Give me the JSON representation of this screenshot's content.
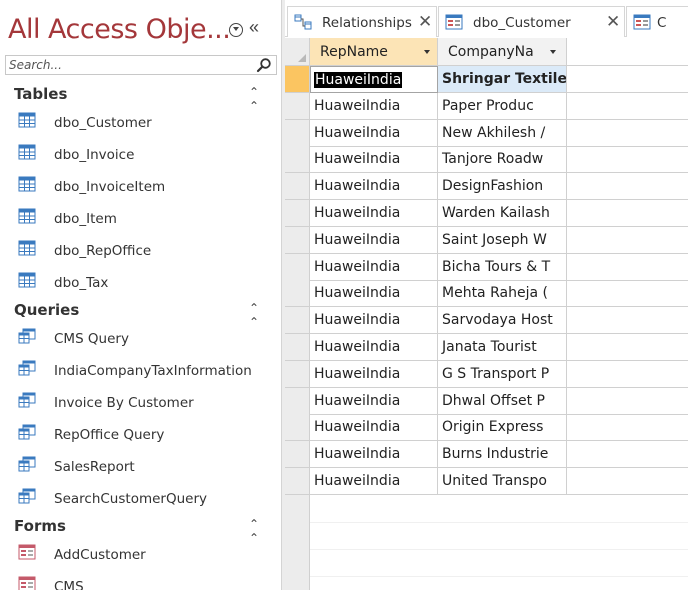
{
  "nav": {
    "title": "All Access Obje...",
    "collapse_glyph": "«",
    "search_placeholder": "Search...",
    "groups": [
      {
        "title": "Tables",
        "chevron": "≈",
        "icon": "table-icon",
        "items": [
          "dbo_Customer",
          "dbo_Invoice",
          "dbo_InvoiceItem",
          "dbo_Item",
          "dbo_RepOffice",
          "dbo_Tax"
        ]
      },
      {
        "title": "Queries",
        "chevron": "≈",
        "icon": "query-icon",
        "items": [
          "CMS Query",
          "IndiaCompanyTaxInformation",
          "Invoice By Customer",
          "RepOffice Query",
          "SalesReport",
          "SearchCustomerQuery"
        ]
      },
      {
        "title": "Forms",
        "chevron": "≈",
        "icon": "form-icon",
        "items": [
          "AddCustomer",
          "CMS"
        ]
      }
    ]
  },
  "tabs": [
    {
      "label": "Relationships",
      "icon": "relationships-icon",
      "close": "✕"
    },
    {
      "label": "dbo_Customer",
      "icon": "table-form-icon",
      "close": "✕"
    },
    {
      "label": "C",
      "icon": "table-form-icon"
    }
  ],
  "grid": {
    "columns": [
      "RepName",
      "CompanyNa"
    ],
    "rows": [
      [
        "HuaweiIndia",
        "Shringar Textile"
      ],
      [
        "HuaweiIndia",
        "Paper Produc"
      ],
      [
        "HuaweiIndia",
        "New Akhilesh /"
      ],
      [
        "HuaweiIndia",
        "Tanjore Roadw"
      ],
      [
        "HuaweiIndia",
        "DesignFashion"
      ],
      [
        "HuaweiIndia",
        "Warden Kailash"
      ],
      [
        "HuaweiIndia",
        "Saint Joseph W"
      ],
      [
        "HuaweiIndia",
        "Bicha Tours & T"
      ],
      [
        "HuaweiIndia",
        "Mehta Raheja ("
      ],
      [
        "HuaweiIndia",
        "Sarvodaya Host"
      ],
      [
        "HuaweiIndia",
        "Janata Tourist"
      ],
      [
        "HuaweiIndia",
        "G S Transport P"
      ],
      [
        "HuaweiIndia",
        "Dhwal Offset P"
      ],
      [
        "HuaweiIndia",
        "Origin Express"
      ],
      [
        "HuaweiIndia",
        "Burns Industrie"
      ],
      [
        "HuaweiIndia",
        "United Transpo"
      ]
    ]
  },
  "colors": {
    "title": "#a4373a",
    "active_column_header": "#fce4b6",
    "active_record_selector": "#fbc561",
    "selected_cell": "#dbeaf8"
  }
}
